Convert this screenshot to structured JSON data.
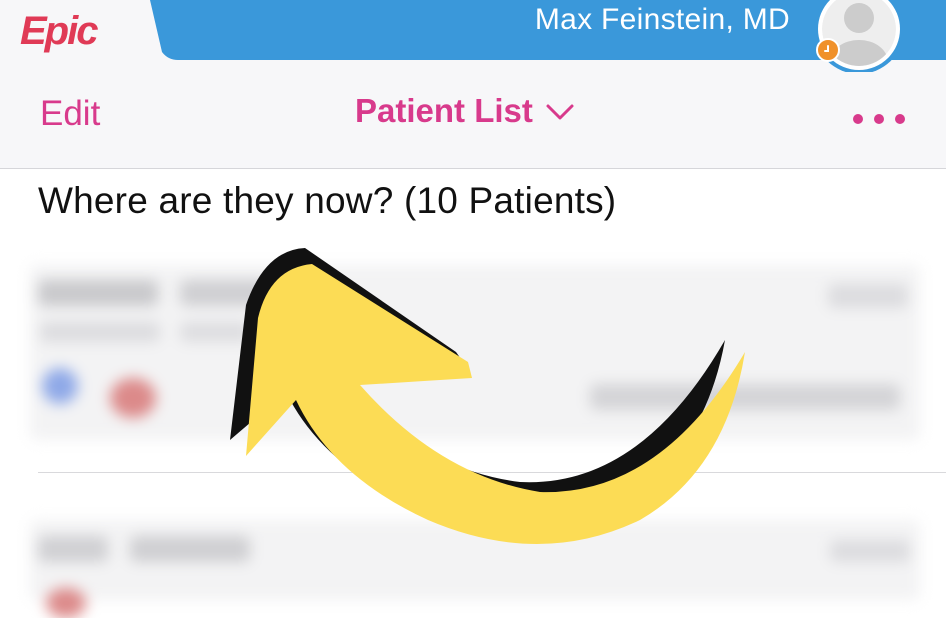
{
  "header": {
    "brand": "Epic",
    "user_name": "Max Feinstein, MD",
    "banner_color": "#3a98da",
    "brand_color": "#e03a56",
    "avatar_icon": "user-avatar-icon",
    "status_icon": "clock-icon",
    "status_color": "#f0912a"
  },
  "navbar": {
    "edit_label": "Edit",
    "list_label": "Patient List",
    "list_dropdown_icon": "chevron-down-icon",
    "more_icon": "more-options-icon",
    "accent_color": "#d83a8c"
  },
  "main": {
    "list_title": "Where are they now?  (10 Patients)"
  },
  "annotation": {
    "arrow_icon": "curved-arrow-icon",
    "arrow_color": "#fcdc55"
  }
}
